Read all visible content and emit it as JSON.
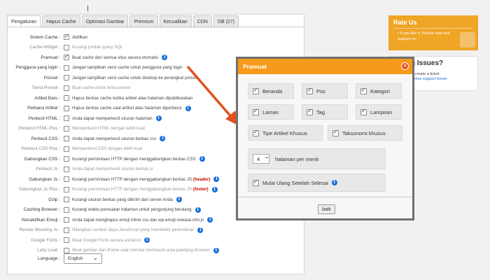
{
  "tabs": [
    "Pengaturan",
    "Hapus Cache",
    "Optimasi Gambar",
    "Premium",
    "Kecualikan",
    "CDN",
    "DB (27)"
  ],
  "settings": [
    {
      "label": "Sistem Cache :",
      "checked": true,
      "text": "Aktifkan",
      "info": false,
      "dim": false
    },
    {
      "label": "Cache Widget :",
      "checked": false,
      "text": "Kurangi jumlah query SQL",
      "info": false,
      "dim": true
    },
    {
      "label": "Pramuat :",
      "checked": true,
      "text": "Buat cache dari semua situs secara otomatis",
      "info": true,
      "dim": false
    },
    {
      "label": "Pengguna yang login :",
      "checked": false,
      "text": "Jangan tampilkan versi cache untuk pengguna yang login",
      "info": false,
      "dim": false
    },
    {
      "label": "Ponsel :",
      "checked": false,
      "text": "Jangan tampilkan versi cache untuk desktop ke perangkat ponsel",
      "info": false,
      "dim": false
    },
    {
      "label": "Tema Ponsel :",
      "checked": false,
      "text": "Buat cache untuk tema ponsel",
      "info": false,
      "dim": true
    },
    {
      "label": "Artikel Baru :",
      "checked": false,
      "text": "Hapus berkas cache ketika artikel atau halaman dipublikasikan",
      "info": false,
      "dim": false
    },
    {
      "label": "Perbarui Artikel :",
      "checked": false,
      "text": "Hapus berkas cache saat artikel atau halaman diperbarui",
      "info": true,
      "dim": false
    },
    {
      "label": "Perkecil HTML :",
      "checked": false,
      "text": "Anda dapat memperkecil ukuran halaman",
      "info": true,
      "dim": false
    },
    {
      "label": "Perkecil HTML Plus :",
      "checked": false,
      "text": "Memperkecil HTML dengan lebih kuat",
      "info": false,
      "dim": true
    },
    {
      "label": "Perkecil CSS :",
      "checked": false,
      "text": "Anda dapat memperkecil ukuran berkas css",
      "info": true,
      "dim": false
    },
    {
      "label": "Perkecil CSS Plus :",
      "checked": false,
      "text": "Memperkecil CSS dengan lebih kuat",
      "info": false,
      "dim": true
    },
    {
      "label": "Gabungkan CSS :",
      "checked": false,
      "text": "Kurangi permintaan HTTP dengan menggabungkan berkas CSS",
      "info": true,
      "dim": false
    },
    {
      "label": "Perkecil Js :",
      "checked": false,
      "text": "Anda dapat memperkecil ukuran berkas js",
      "info": false,
      "dim": true
    },
    {
      "label": "Gabungkan Js :",
      "checked": false,
      "text": "Kurangi permintaan HTTP dengan menggabungkan berkas JS",
      "tag": "(header)",
      "info": true,
      "dim": false
    },
    {
      "label": "Gabungkan Js Plus :",
      "checked": false,
      "text": "Kurangi permintaan HTTP dengan menggabungkan berkas JS",
      "tag": "(footer)",
      "info": true,
      "dim": true
    },
    {
      "label": "Gzip :",
      "checked": false,
      "text": "Kurangi ukuran berkas yang dikirim dari server Anda",
      "info": true,
      "dim": false
    },
    {
      "label": "Caching Browser :",
      "checked": false,
      "text": "Kurangi waktu pemuatan halaman untuk pengunjung berulang",
      "info": true,
      "dim": false
    },
    {
      "label": "Nonaktifkan Emoji :",
      "checked": false,
      "text": "Anda dapat menghapus emoji inline css dan wp-emoji-release.min.js",
      "info": true,
      "dim": false
    },
    {
      "label": "Render Blocking Js :",
      "checked": false,
      "text": "Hilangkan sumber daya JavaScript yang memblokir perenderan",
      "info": true,
      "dim": true
    },
    {
      "label": "Google Fonts :",
      "checked": false,
      "text": "Muat Google Fonts secara asinkron",
      "info": true,
      "dim": true
    },
    {
      "label": "Lazy Load :",
      "checked": false,
      "text": "Muat gambar dan iframe saat mereka memasuki area pandang browser",
      "info": true,
      "dim": true
    }
  ],
  "language": {
    "label": "Language :",
    "value": "English"
  },
  "rate": {
    "title": "Rate Us",
    "text": "If you like it, Please vote and support us."
  },
  "support": {
    "title": "g Issues?",
    "text1": "n create a ticket",
    "link": "Press support forum"
  },
  "modal": {
    "title": "Pramuat",
    "options": [
      {
        "label": "Beranda",
        "checked": true
      },
      {
        "label": "Pos",
        "checked": true
      },
      {
        "label": "Kategori",
        "checked": true
      },
      {
        "label": "Laman",
        "checked": true
      },
      {
        "label": "Tag",
        "checked": true
      },
      {
        "label": "Lampiran",
        "checked": true
      }
    ],
    "wide": [
      {
        "label": "Tipe Artikel Khusus",
        "checked": true
      },
      {
        "label": "Taksonomi khusus",
        "checked": true
      }
    ],
    "pages_value": "4",
    "pages_label": "halaman per menit",
    "restart_label": "Mulai Ulang Setelah Selesai",
    "close_label": "baik"
  },
  "accent": "#f59a1a",
  "arrow_color": "#e2521d"
}
